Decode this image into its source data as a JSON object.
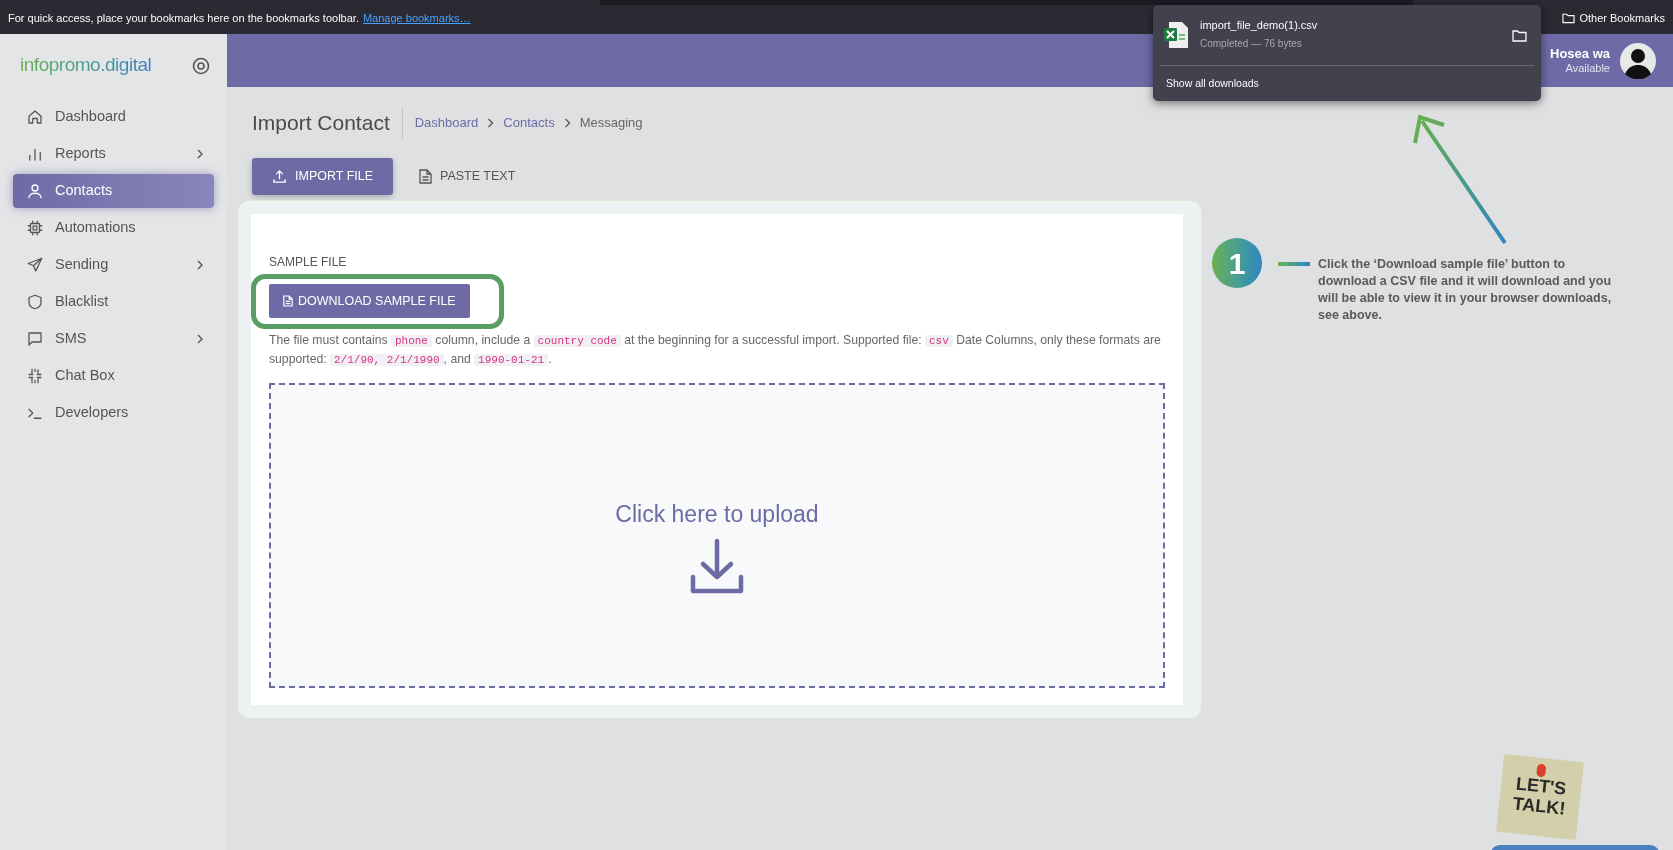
{
  "browser": {
    "bookmarks_hint": "For quick access, place your bookmarks here on the bookmarks toolbar.",
    "manage_link": "Manage bookmarks…",
    "other_bookmarks": "Other Bookmarks"
  },
  "downloads_popup": {
    "file_name": "import_file_demo(1).csv",
    "status": "Completed — 76 bytes",
    "show_all": "Show all downloads"
  },
  "sidebar": {
    "logo": "infopromo.digital",
    "items": [
      {
        "label": "Dashboard",
        "selected": false,
        "has_submenu": false
      },
      {
        "label": "Reports",
        "selected": false,
        "has_submenu": true
      },
      {
        "label": "Contacts",
        "selected": true,
        "has_submenu": false
      },
      {
        "label": "Automations",
        "selected": false,
        "has_submenu": false
      },
      {
        "label": "Sending",
        "selected": false,
        "has_submenu": true
      },
      {
        "label": "Blacklist",
        "selected": false,
        "has_submenu": false
      },
      {
        "label": "SMS",
        "selected": false,
        "has_submenu": true
      },
      {
        "label": "Chat Box",
        "selected": false,
        "has_submenu": false
      },
      {
        "label": "Developers",
        "selected": false,
        "has_submenu": false
      }
    ]
  },
  "header": {
    "user_name": "Hosea wa",
    "user_status": "Available"
  },
  "page": {
    "title": "Import Contact",
    "breadcrumbs": [
      {
        "label": "Dashboard",
        "kind": "link"
      },
      {
        "label": "Contacts",
        "kind": "link"
      },
      {
        "label": "Messaging",
        "kind": "current"
      }
    ],
    "tabs": [
      {
        "label": "IMPORT FILE",
        "selected": true
      },
      {
        "label": "PASTE TEXT",
        "selected": false
      }
    ]
  },
  "card": {
    "section_label": "SAMPLE FILE",
    "download_button": "DOWNLOAD SAMPLE FILE",
    "note": [
      {
        "kind": "text",
        "text": "The file must contains "
      },
      {
        "kind": "code",
        "text": "phone"
      },
      {
        "kind": "text",
        "text": " column, include a "
      },
      {
        "kind": "code",
        "text": "country code"
      },
      {
        "kind": "text",
        "text": " at the beginning for a successful import. Supported file: "
      },
      {
        "kind": "code",
        "text": "csv"
      },
      {
        "kind": "text",
        "text": " Date Columns, only these formats are supported: "
      },
      {
        "kind": "code",
        "text": "2/1/90, 2/1/1990"
      },
      {
        "kind": "text",
        "text": ", and "
      },
      {
        "kind": "code",
        "text": "1990-01-21"
      },
      {
        "kind": "text",
        "text": "."
      }
    ],
    "dropzone_text": "Click here to upload"
  },
  "annotation": {
    "step": "1",
    "text": "Click the ‘Download sample file’ button to download a CSV file and it will download and you will be able to view it in your browser downloads, see above."
  },
  "lets_talk": {
    "line_1": "LET'S",
    "line_2": "TALK!"
  }
}
